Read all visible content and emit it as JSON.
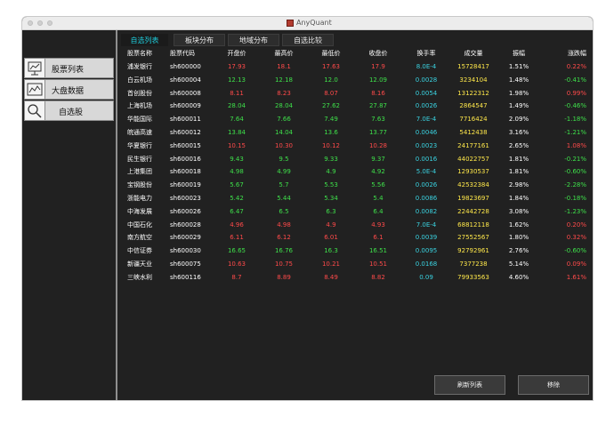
{
  "window": {
    "title": "AnyQuant"
  },
  "sidebar": {
    "items": [
      {
        "label": "股票列表",
        "icon": "stock-board-icon"
      },
      {
        "label": "大盘数据",
        "icon": "line-chart-icon"
      },
      {
        "label": "自选股",
        "icon": "magnifier-icon"
      }
    ]
  },
  "tabs": [
    {
      "label": "自选列表",
      "active": true
    },
    {
      "label": "板块分布",
      "active": false
    },
    {
      "label": "地域分布",
      "active": false
    },
    {
      "label": "自选比较",
      "active": false
    }
  ],
  "table": {
    "headers": [
      "股票名称",
      "股票代码",
      "开盘价",
      "最高价",
      "最低价",
      "收盘价",
      "换手率",
      "成交量",
      "振幅",
      "涨跌幅"
    ],
    "rows": [
      {
        "name": "浦发银行",
        "code": "sh600000",
        "open": "17.93",
        "high": "18.1",
        "low": "17.63",
        "close": "17.9",
        "turnover": "8.0E-4",
        "volume": "15728417",
        "amplitude": "1.51%",
        "change": "0.22%",
        "trend": "up"
      },
      {
        "name": "白云机场",
        "code": "sh600004",
        "open": "12.13",
        "high": "12.18",
        "low": "12.0",
        "close": "12.09",
        "turnover": "0.0028",
        "volume": "3234104",
        "amplitude": "1.48%",
        "change": "-0.41%",
        "trend": "down"
      },
      {
        "name": "首创股份",
        "code": "sh600008",
        "open": "8.11",
        "high": "8.23",
        "low": "8.07",
        "close": "8.16",
        "turnover": "0.0054",
        "volume": "13122312",
        "amplitude": "1.98%",
        "change": "0.99%",
        "trend": "up"
      },
      {
        "name": "上海机场",
        "code": "sh600009",
        "open": "28.04",
        "high": "28.04",
        "low": "27.62",
        "close": "27.87",
        "turnover": "0.0026",
        "volume": "2864547",
        "amplitude": "1.49%",
        "change": "-0.46%",
        "trend": "down"
      },
      {
        "name": "华能国际",
        "code": "sh600011",
        "open": "7.64",
        "high": "7.66",
        "low": "7.49",
        "close": "7.63",
        "turnover": "7.0E-4",
        "volume": "7716424",
        "amplitude": "2.09%",
        "change": "-1.18%",
        "trend": "down"
      },
      {
        "name": "皖通高速",
        "code": "sh600012",
        "open": "13.84",
        "high": "14.04",
        "low": "13.6",
        "close": "13.77",
        "turnover": "0.0046",
        "volume": "5412438",
        "amplitude": "3.16%",
        "change": "-1.21%",
        "trend": "down"
      },
      {
        "name": "华夏银行",
        "code": "sh600015",
        "open": "10.15",
        "high": "10.30",
        "low": "10.12",
        "close": "10.28",
        "turnover": "0.0023",
        "volume": "24177161",
        "amplitude": "2.65%",
        "change": "1.08%",
        "trend": "up"
      },
      {
        "name": "民生银行",
        "code": "sh600016",
        "open": "9.43",
        "high": "9.5",
        "low": "9.33",
        "close": "9.37",
        "turnover": "0.0016",
        "volume": "44022757",
        "amplitude": "1.81%",
        "change": "-0.21%",
        "trend": "down"
      },
      {
        "name": "上港集团",
        "code": "sh600018",
        "open": "4.98",
        "high": "4.99",
        "low": "4.9",
        "close": "4.92",
        "turnover": "5.0E-4",
        "volume": "12930537",
        "amplitude": "1.81%",
        "change": "-0.60%",
        "trend": "down"
      },
      {
        "name": "宝钢股份",
        "code": "sh600019",
        "open": "5.67",
        "high": "5.7",
        "low": "5.53",
        "close": "5.56",
        "turnover": "0.0026",
        "volume": "42532384",
        "amplitude": "2.98%",
        "change": "-2.28%",
        "trend": "down"
      },
      {
        "name": "浙能电力",
        "code": "sh600023",
        "open": "5.42",
        "high": "5.44",
        "low": "5.34",
        "close": "5.4",
        "turnover": "0.0086",
        "volume": "19823697",
        "amplitude": "1.84%",
        "change": "-0.18%",
        "trend": "down"
      },
      {
        "name": "中海发展",
        "code": "sh600026",
        "open": "6.47",
        "high": "6.5",
        "low": "6.3",
        "close": "6.4",
        "turnover": "0.0082",
        "volume": "22442728",
        "amplitude": "3.08%",
        "change": "-1.23%",
        "trend": "down"
      },
      {
        "name": "中国石化",
        "code": "sh600028",
        "open": "4.96",
        "high": "4.98",
        "low": "4.9",
        "close": "4.93",
        "turnover": "7.0E-4",
        "volume": "68812118",
        "amplitude": "1.62%",
        "change": "0.20%",
        "trend": "up"
      },
      {
        "name": "南方航空",
        "code": "sh600029",
        "open": "6.11",
        "high": "6.12",
        "low": "6.01",
        "close": "6.1",
        "turnover": "0.0039",
        "volume": "27552567",
        "amplitude": "1.80%",
        "change": "0.32%",
        "trend": "up"
      },
      {
        "name": "中信证券",
        "code": "sh600030",
        "open": "16.65",
        "high": "16.76",
        "low": "16.3",
        "close": "16.51",
        "turnover": "0.0095",
        "volume": "92792961",
        "amplitude": "2.76%",
        "change": "-0.60%",
        "trend": "down"
      },
      {
        "name": "新疆天业",
        "code": "sh600075",
        "open": "10.63",
        "high": "10.75",
        "low": "10.21",
        "close": "10.51",
        "turnover": "0.0168",
        "volume": "7377238",
        "amplitude": "5.14%",
        "change": "0.09%",
        "trend": "up"
      },
      {
        "name": "三峡水利",
        "code": "sh600116",
        "open": "8.7",
        "high": "8.89",
        "low": "8.49",
        "close": "8.82",
        "turnover": "0.09",
        "volume": "79933563",
        "amplitude": "4.60%",
        "change": "1.61%",
        "trend": "up"
      }
    ]
  },
  "buttons": {
    "refresh": "刷新列表",
    "remove": "移除"
  },
  "colors": {
    "up": "#ff4a4a",
    "down": "#3ee04a",
    "accent": "#1ec9d8",
    "volume": "#ffe84a"
  }
}
